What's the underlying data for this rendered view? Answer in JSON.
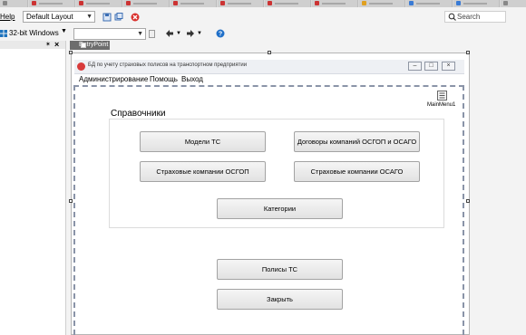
{
  "ide": {
    "menu_help": "Help",
    "layout_combo": "Default Layout",
    "platform_combo": "32-bit Windows",
    "config_combo": "",
    "search_placeholder": "Search",
    "document_tab": "EntryPoint",
    "pin_glyph": "✶",
    "close_glyph": "×"
  },
  "form": {
    "title": "БД по учету страховых полисов на транспортном предприятии",
    "menu": [
      "Администрирование",
      "Помощь",
      "Выход"
    ],
    "main_menu_component": "MainMenu1",
    "group_title": "Справочники",
    "buttons": {
      "models": "Модели ТС",
      "contracts": "Договоры компаний ОСГОП и ОСАГО",
      "osgop": "Страховые компании ОСГОП",
      "osago": "Страховые компании ОСАГО",
      "categories": "Категории",
      "policies": "Полисы ТС",
      "close": "Закрыть"
    }
  },
  "colors": {
    "app_icon": "#d83b3b",
    "help_icon": "#1f6fc8",
    "dash_frame": "#8a94a8"
  }
}
